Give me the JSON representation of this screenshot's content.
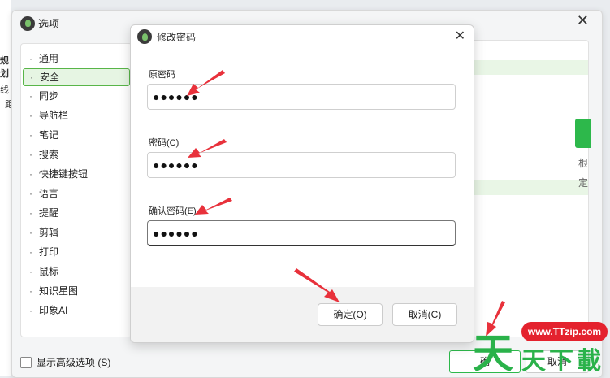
{
  "background_app": {
    "fragments": [
      "规划",
      "线",
      "距"
    ]
  },
  "options_window": {
    "title": "选项",
    "close_glyph": "✕",
    "sidebar_items": [
      {
        "label": "通用"
      },
      {
        "label": "安全",
        "selected": true
      },
      {
        "label": "同步"
      },
      {
        "label": "导航栏"
      },
      {
        "label": "笔记"
      },
      {
        "label": "搜索"
      },
      {
        "label": "快捷键按钮"
      },
      {
        "label": "语言"
      },
      {
        "label": "提醒"
      },
      {
        "label": "剪辑"
      },
      {
        "label": "打印"
      },
      {
        "label": "鼠标"
      },
      {
        "label": "知识星图"
      },
      {
        "label": "印象AI"
      }
    ],
    "right_fragments": [
      "根",
      "定"
    ],
    "show_advanced_label": "显示高级选项 (S)",
    "ok_label": "确",
    "cancel_label": "取消"
  },
  "dialog": {
    "title": "修改密码",
    "close_glyph": "✕",
    "old_password_label": "原密码",
    "old_password_value": "●●●●●●",
    "password_label": "密码(C)",
    "password_value": "●●●●●●",
    "confirm_label": "确认密码(E)",
    "confirm_value": "●●●●●●",
    "ok_label": "确定(O)",
    "cancel_label": "取消(C)"
  },
  "watermark": {
    "site": "www.TTzip.com",
    "char_big": "天",
    "chars_small": [
      "天",
      "下",
      "載"
    ]
  },
  "colors": {
    "accent_green": "#2db84b",
    "annotation_red": "#e8313b"
  }
}
